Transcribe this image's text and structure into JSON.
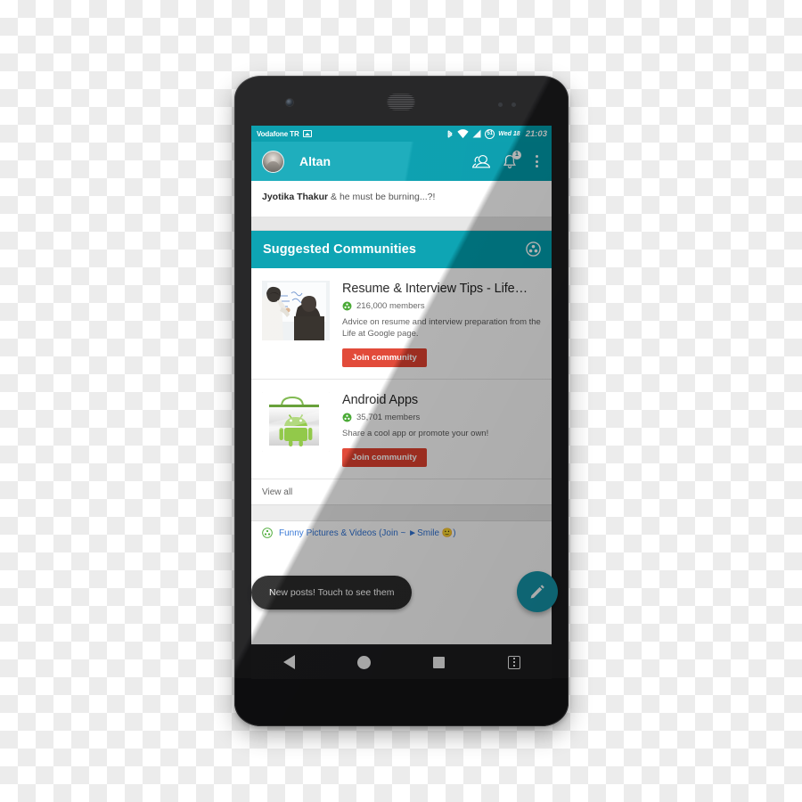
{
  "status_bar": {
    "carrier": "Vodafone TR",
    "image_icon": "photo-icon",
    "bluetooth_icon": "bluetooth-icon",
    "wifi_icon": "wifi-icon",
    "signal_icon": "cell-signal-icon",
    "battery_level": "51",
    "date": "Wed 18",
    "time": "21:03"
  },
  "app_bar": {
    "avatar": "user-avatar",
    "title": "Altan",
    "actions": {
      "communities_icon": "people-icon",
      "notifications_icon": "bell-icon",
      "notifications_badge": "1",
      "overflow_icon": "more-vertical-icon"
    },
    "accent_color": "#00a3b4"
  },
  "post_teaser": {
    "author": "Jyotika Thakur",
    "text": " & he must be burning...?!"
  },
  "suggested_section": {
    "title": "Suggested Communities",
    "header_icon": "communities-circle-icon",
    "header_color": "#00a0b0",
    "view_all_label": "View all"
  },
  "communities": [
    {
      "name": "Resume & Interview Tips - Life…",
      "members": "216,000 members",
      "members_icon": "community-badge-icon",
      "description": "Advice on resume and interview preparation from the Life at Google page.",
      "join_label": "Join community",
      "thumbnail": "whiteboard-meeting-photo"
    },
    {
      "name": "Android Apps",
      "members": "35,701 members",
      "members_icon": "community-badge-icon",
      "description": "Share a cool app or promote your own!",
      "join_label": "Join community",
      "thumbnail": "android-market-bag-icon"
    }
  ],
  "bottom_link": {
    "icon": "community-badge-icon",
    "label": "Funny Pictures & Videos (Join  ~ ►Smile 🙂)",
    "color": "#2f72d4"
  },
  "toast": {
    "message": "New posts! Touch to see them"
  },
  "fab": {
    "icon": "pencil-edit-icon",
    "color": "#1596ab"
  },
  "nav_bar": {
    "back": "back-triangle-icon",
    "home": "home-circle-icon",
    "recents": "recents-square-icon",
    "extra": "menu-card-icon"
  },
  "colors": {
    "teal": "#00a3b4",
    "join_red": "#e0412f",
    "link_blue": "#2f72d4",
    "green": "#3fa52a"
  }
}
